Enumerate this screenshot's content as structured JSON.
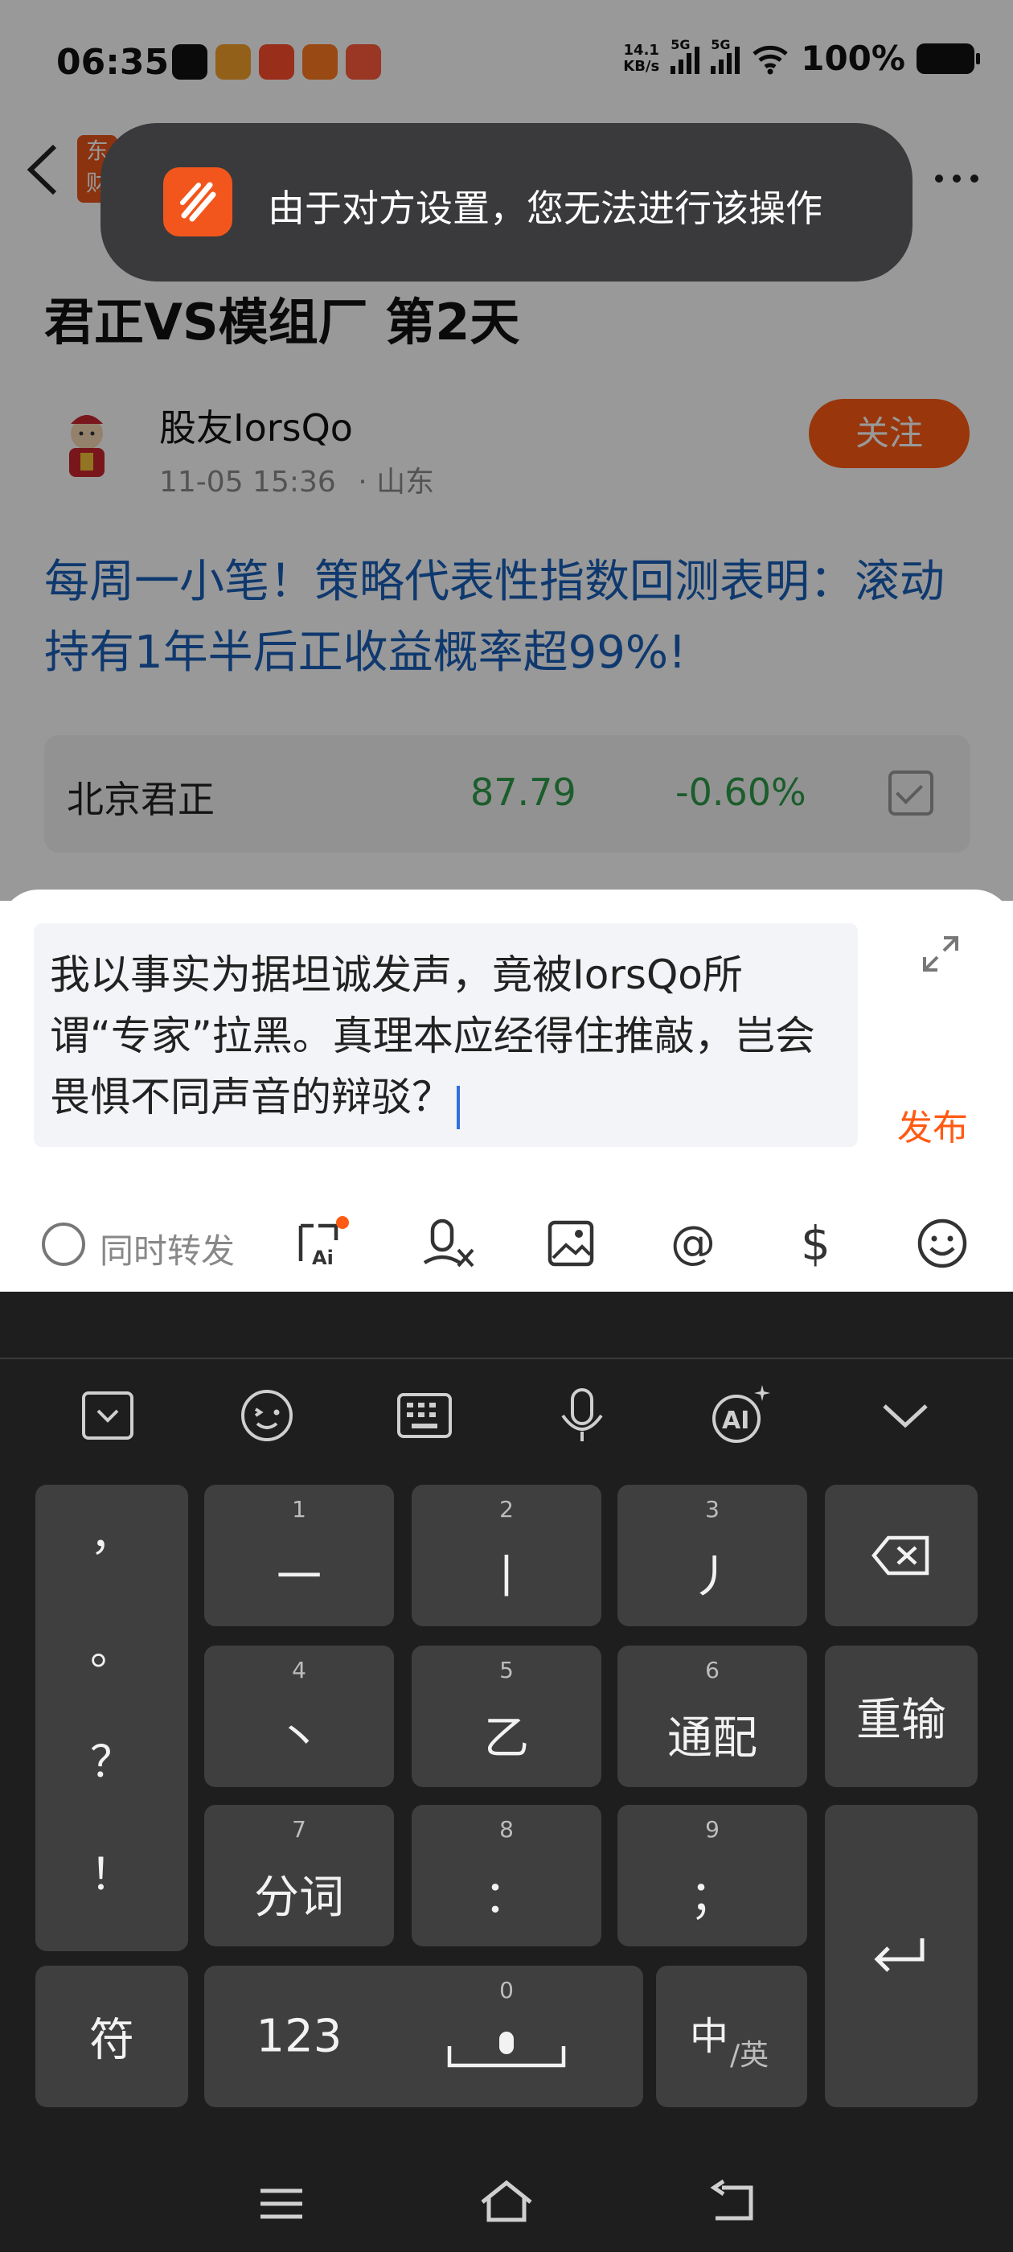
{
  "status_bar": {
    "time": "06:35",
    "net_speed_value": "14.1",
    "net_speed_unit": "KB/s",
    "sim1": "5G",
    "sim2": "5G",
    "battery": "100%"
  },
  "header": {
    "logo_text": "东财",
    "back_icon": "chevron-left-icon",
    "more_icon": "more-horizontal-icon"
  },
  "toast": {
    "message": "由于对方设置，您无法进行该操作",
    "icon": "eastmoney-logo-icon"
  },
  "post": {
    "title": "君正VS模组厂 第2天",
    "author": "股友IorsQo",
    "datetime": "11-05 15:36",
    "location": "· 山东",
    "follow_label": "关注",
    "promo_text": "每周一小笔！策略代表性指数回测表明：滚动持有1年半后正收益概率超99%!"
  },
  "stock": {
    "name": "北京君正",
    "price": "87.79",
    "change": "-0.60%",
    "color": "#2d9c48"
  },
  "compose": {
    "text": "我以事实为据坦诚发声，竟被IorsQo所谓“专家”拉黑。真理本应经得住推敲，岂会畏惧不同声音的辩驳？",
    "publish_label": "发布",
    "repost_label": "同时转发",
    "accent_color": "#ff5a13",
    "tools": [
      "ask-ai-icon",
      "voice-translate-icon",
      "image-icon",
      "at-icon",
      "dollar-icon",
      "emoji-icon"
    ]
  },
  "keyboard": {
    "toolbar": [
      "clipboard-icon",
      "emoji-icon",
      "keyboard-layout-icon",
      "microphone-icon",
      "ai-icon",
      "collapse-icon"
    ],
    "punctuation": [
      "，",
      "。",
      "？",
      "！"
    ],
    "keys": {
      "k1": {
        "num": "1",
        "label": "一"
      },
      "k2": {
        "num": "2",
        "label": "丨"
      },
      "k3": {
        "num": "3",
        "label": "丿"
      },
      "k4": {
        "num": "4",
        "label": "丶"
      },
      "k5": {
        "num": "5",
        "label": "乙"
      },
      "k6": {
        "num": "6",
        "label": "通配"
      },
      "k7": {
        "num": "7",
        "label": "分词"
      },
      "k8": {
        "num": "8",
        "label": "："
      },
      "k9": {
        "num": "9",
        "label": "；"
      },
      "k0": {
        "num": "0"
      }
    },
    "reenter_label": "重输",
    "symbols_label": "符",
    "numbers_label": "123",
    "lang_main": "中",
    "lang_sub": "/英"
  },
  "nav": [
    "menu-icon",
    "home-icon",
    "back-icon"
  ]
}
